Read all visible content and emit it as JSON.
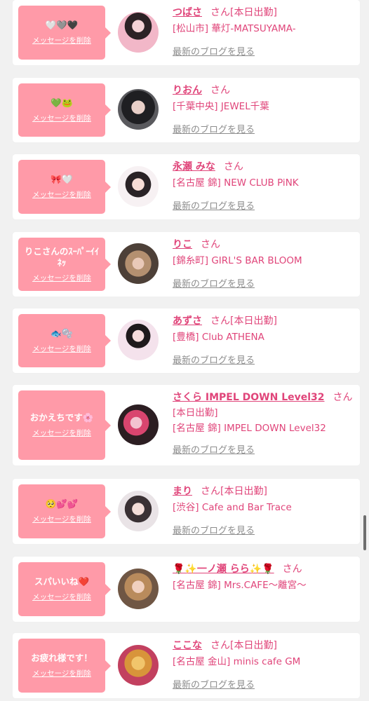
{
  "delete_label": "メッセージを削除",
  "blog_label": "最新のブログを見る",
  "colors": {
    "bubble": "#ff9aa8",
    "name": "#e0457a",
    "link_gray": "#8d8d8d",
    "background": "#f1f1f1"
  },
  "items": [
    {
      "message": "🤍🩶🖤",
      "name": "つばさ",
      "suffix": "さん[本日出勤]",
      "shop": "[松山市] 華灯-MATSUYAMA-",
      "avatar": "avatar-tsubasa"
    },
    {
      "message": "💚🐸",
      "name": "りおん",
      "suffix": "さん",
      "shop": "[千葉中央] JEWEL千葉",
      "avatar": "avatar-rion"
    },
    {
      "message": "🎀🤍",
      "name": "永瀬 みな",
      "suffix": "さん",
      "shop": "[名古屋 錦] NEW CLUB PiNK",
      "avatar": "avatar-mina"
    },
    {
      "message": "りこさんのｽｰﾊﾟｰｲｲﾈｯ",
      "name": "りこ",
      "suffix": "さん",
      "shop": "[錦糸町] GIRL'S BAR BLOOM",
      "avatar": "avatar-riko"
    },
    {
      "message": "🐟🫧",
      "name": "あずさ",
      "suffix": "さん[本日出勤]",
      "shop": "[豊橋] Club ATHENA",
      "avatar": "avatar-azusa"
    },
    {
      "message": "おかえちです🌸",
      "name": "さくら IMPEL DOWN Level32",
      "suffix": "さん",
      "badge": "[本日出勤]",
      "shop": "[名古屋 錦] IMPEL DOWN Level32",
      "avatar": "avatar-sakura"
    },
    {
      "message": "🥺💕💕",
      "name": "まり",
      "suffix": "さん[本日出勤]",
      "shop": "[渋谷] Cafe and Bar Trace",
      "avatar": "avatar-mari"
    },
    {
      "message": "スパいいね❤️",
      "name": "🌹✨一ノ瀬 らら✨🌹",
      "suffix": "さん",
      "shop": "[名古屋 錦] Mrs.CAFE〜離宮〜",
      "avatar": "avatar-rara"
    },
    {
      "message": "お疲れ様です！",
      "name": "ここな",
      "suffix": "さん[本日出勤]",
      "shop": "[名古屋 金山] minis cafe GM",
      "avatar": "avatar-kokona"
    }
  ]
}
